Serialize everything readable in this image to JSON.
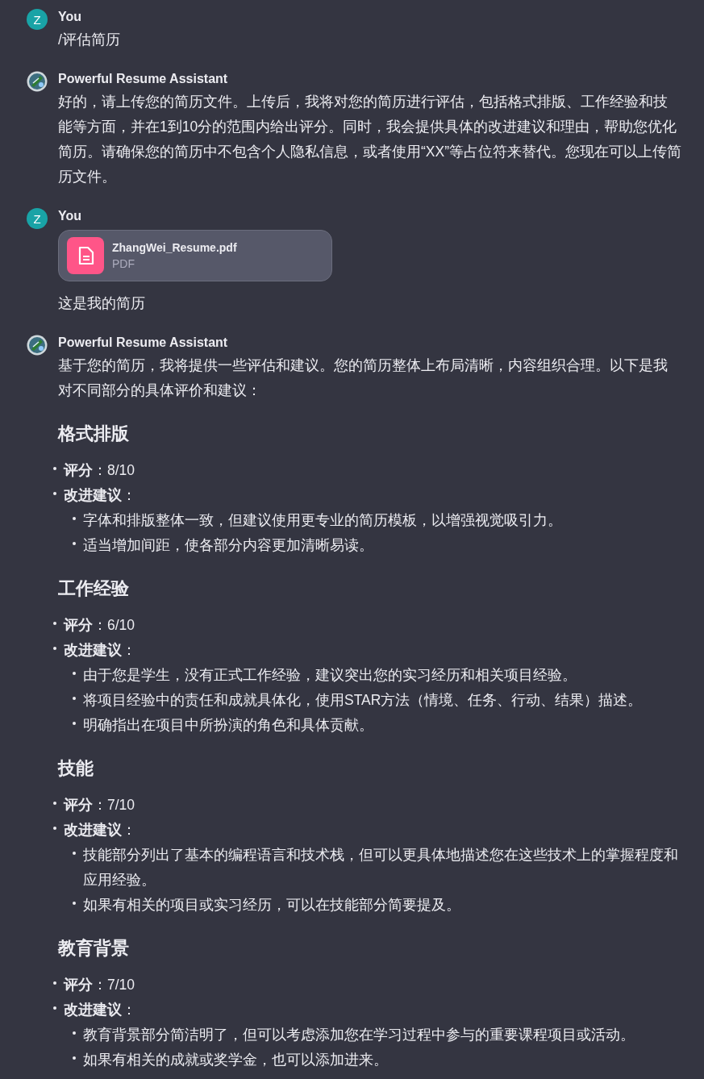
{
  "messages": [
    {
      "kind": "user",
      "author": "You",
      "avatar": "Z",
      "blocks": [
        {
          "kind": "text",
          "text": "/评估简历"
        }
      ]
    },
    {
      "kind": "assistant",
      "author": "Powerful Resume Assistant",
      "blocks": [
        {
          "kind": "text",
          "text": "好的，请上传您的简历文件。上传后，我将对您的简历进行评估，包括格式排版、工作经验和技能等方面，并在1到10分的范围内给出评分。同时，我会提供具体的改进建议和理由，帮助您优化简历。请确保您的简历中不包含个人隐私信息，或者使用“XX”等占位符来替代。您现在可以上传简历文件。"
        }
      ]
    },
    {
      "kind": "user",
      "author": "You",
      "avatar": "Z",
      "blocks": [
        {
          "kind": "file",
          "name": "ZhangWei_Resume.pdf",
          "type": "PDF"
        },
        {
          "kind": "text",
          "text": "这是我的简历"
        }
      ]
    },
    {
      "kind": "assistant",
      "author": "Powerful Resume Assistant",
      "blocks": [
        {
          "kind": "text",
          "text": "基于您的简历，我将提供一些评估和建议。您的简历整体上布局清晰，内容组织合理。以下是我对不同部分的具体评价和建议："
        },
        {
          "kind": "section",
          "heading": "格式排版",
          "items": [
            {
              "text": "**评分**：8/10"
            },
            {
              "text": "**改进建议**：",
              "children": [
                "字体和排版整体一致，但建议使用更专业的简历模板，以增强视觉吸引力。",
                "适当增加间距，使各部分内容更加清晰易读。"
              ]
            }
          ]
        },
        {
          "kind": "section",
          "heading": "工作经验",
          "items": [
            {
              "text": "**评分**：6/10"
            },
            {
              "text": "**改进建议**：",
              "children": [
                "由于您是学生，没有正式工作经验，建议突出您的实习经历和相关项目经验。",
                "将项目经验中的责任和成就具体化，使用STAR方法（情境、任务、行动、结果）描述。",
                "明确指出在项目中所扮演的角色和具体贡献。"
              ]
            }
          ]
        },
        {
          "kind": "section",
          "heading": "技能",
          "items": [
            {
              "text": "**评分**：7/10"
            },
            {
              "text": "**改进建议**：",
              "children": [
                "技能部分列出了基本的编程语言和技术栈，但可以更具体地描述您在这些技术上的掌握程度和应用经验。",
                "如果有相关的项目或实习经历，可以在技能部分简要提及。"
              ]
            }
          ]
        },
        {
          "kind": "section",
          "heading": "教育背景",
          "items": [
            {
              "text": "**评分**：7/10"
            },
            {
              "text": "**改进建议**：",
              "children": [
                "教育背景部分简洁明了，但可以考虑添加您在学习过程中参与的重要课程项目或活动。",
                "如果有相关的成就或奖学金，也可以添加进来。"
              ]
            }
          ]
        }
      ]
    }
  ]
}
